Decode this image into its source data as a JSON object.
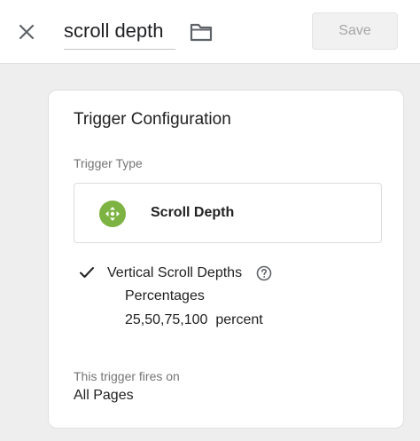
{
  "header": {
    "title": "scroll depth",
    "save_label": "Save"
  },
  "card": {
    "title": "Trigger Configuration",
    "trigger_type_label": "Trigger Type",
    "trigger_type_name": "Scroll Depth",
    "setting": {
      "name": "Vertical Scroll Depths",
      "subtitle": "Percentages",
      "values": "25,50,75,100  percent"
    },
    "fires_on_label": "This trigger fires on",
    "fires_on_value": "All Pages"
  },
  "colors": {
    "icon_green": "#7cb342",
    "save_disabled_text": "#a6a6a6"
  },
  "icons": {
    "close": "close-icon",
    "folder": "folder-icon",
    "trigger": "scroll-depth-icon",
    "check": "check-icon",
    "help": "help-icon"
  }
}
